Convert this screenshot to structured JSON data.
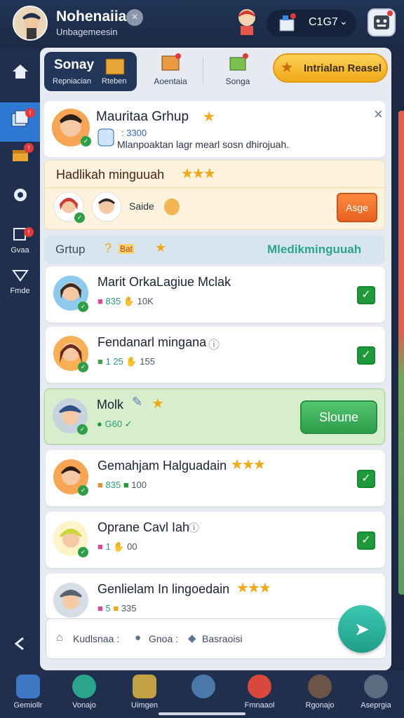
{
  "top": {
    "player_name": "Nohenaiia",
    "player_sub": "Unbagemeesin",
    "close_icon": "close-icon",
    "currency_value": "C1G7",
    "currency_chevron": "⌄"
  },
  "sidebar": {
    "items": [
      {
        "icon": "home-icon",
        "label": ""
      },
      {
        "icon": "cards-icon",
        "label": ""
      },
      {
        "icon": "chest-icon",
        "label": ""
      },
      {
        "icon": "settings-icon",
        "label": ""
      },
      {
        "icon": "chat-icon",
        "label": "Gvaa"
      },
      {
        "icon": "down-triangle-icon",
        "label": "Fmde"
      },
      {
        "icon": "back-arrow-icon",
        "label": ""
      }
    ]
  },
  "tabs": {
    "active_title": "Sonay",
    "active_sub_left": "Repniacian",
    "active_sub_right": "Rteben",
    "tab2_label": "Aoentaia",
    "tab3_label": "Songa",
    "cta_label": "Intrialan Reasel"
  },
  "header_card": {
    "title": "Mauritaa Grhup",
    "badge_value": ": 3300",
    "description": "Mlanpoaktan lagr mearl sosn dhirojuah.",
    "close": "×"
  },
  "friend_panel": {
    "title": "Hadlikah minguuah",
    "sadie_label": "Saide",
    "button_label": "Asge"
  },
  "group_header": {
    "left_label": "Grtup",
    "mini_label": "Bat",
    "right_label": "Mledikminguuah"
  },
  "list": [
    {
      "title": "Marit OrkaLagiue Mclak",
      "m1": "835",
      "m2": "10K",
      "action": "check"
    },
    {
      "title": "Fendanarl mingana",
      "m1": "1 25",
      "m2": "155",
      "action": "check"
    },
    {
      "title": "Molk",
      "m1": "G60",
      "m2": "",
      "action": "button",
      "button_label": "Sloune"
    },
    {
      "title": "Gemahjam Halguadain",
      "m1": "835",
      "m2": "100",
      "action": "check"
    },
    {
      "title": "Oprane Cavl Iah",
      "m1": "1",
      "m2": "00",
      "action": "check"
    },
    {
      "title": "Genlielam In lingoedain",
      "m1": "5",
      "m2": "335",
      "action": "check"
    }
  ],
  "search": {
    "part1": "Kudlsnaa :",
    "part2": "Gnoa :",
    "part3": "Basraoisi"
  },
  "bottom_nav": [
    {
      "label": "Gemiollr",
      "icon": "house-icon"
    },
    {
      "label": "Vonajo",
      "icon": "compass-icon"
    },
    {
      "label": "Uimgen",
      "icon": "map-icon"
    },
    {
      "label": "",
      "icon": "creature-icon"
    },
    {
      "label": "Fmnaaol",
      "icon": "face-icon"
    },
    {
      "label": "Rgonajo",
      "icon": "character-icon"
    },
    {
      "label": "Aseprgia",
      "icon": "profile-icon"
    }
  ]
}
